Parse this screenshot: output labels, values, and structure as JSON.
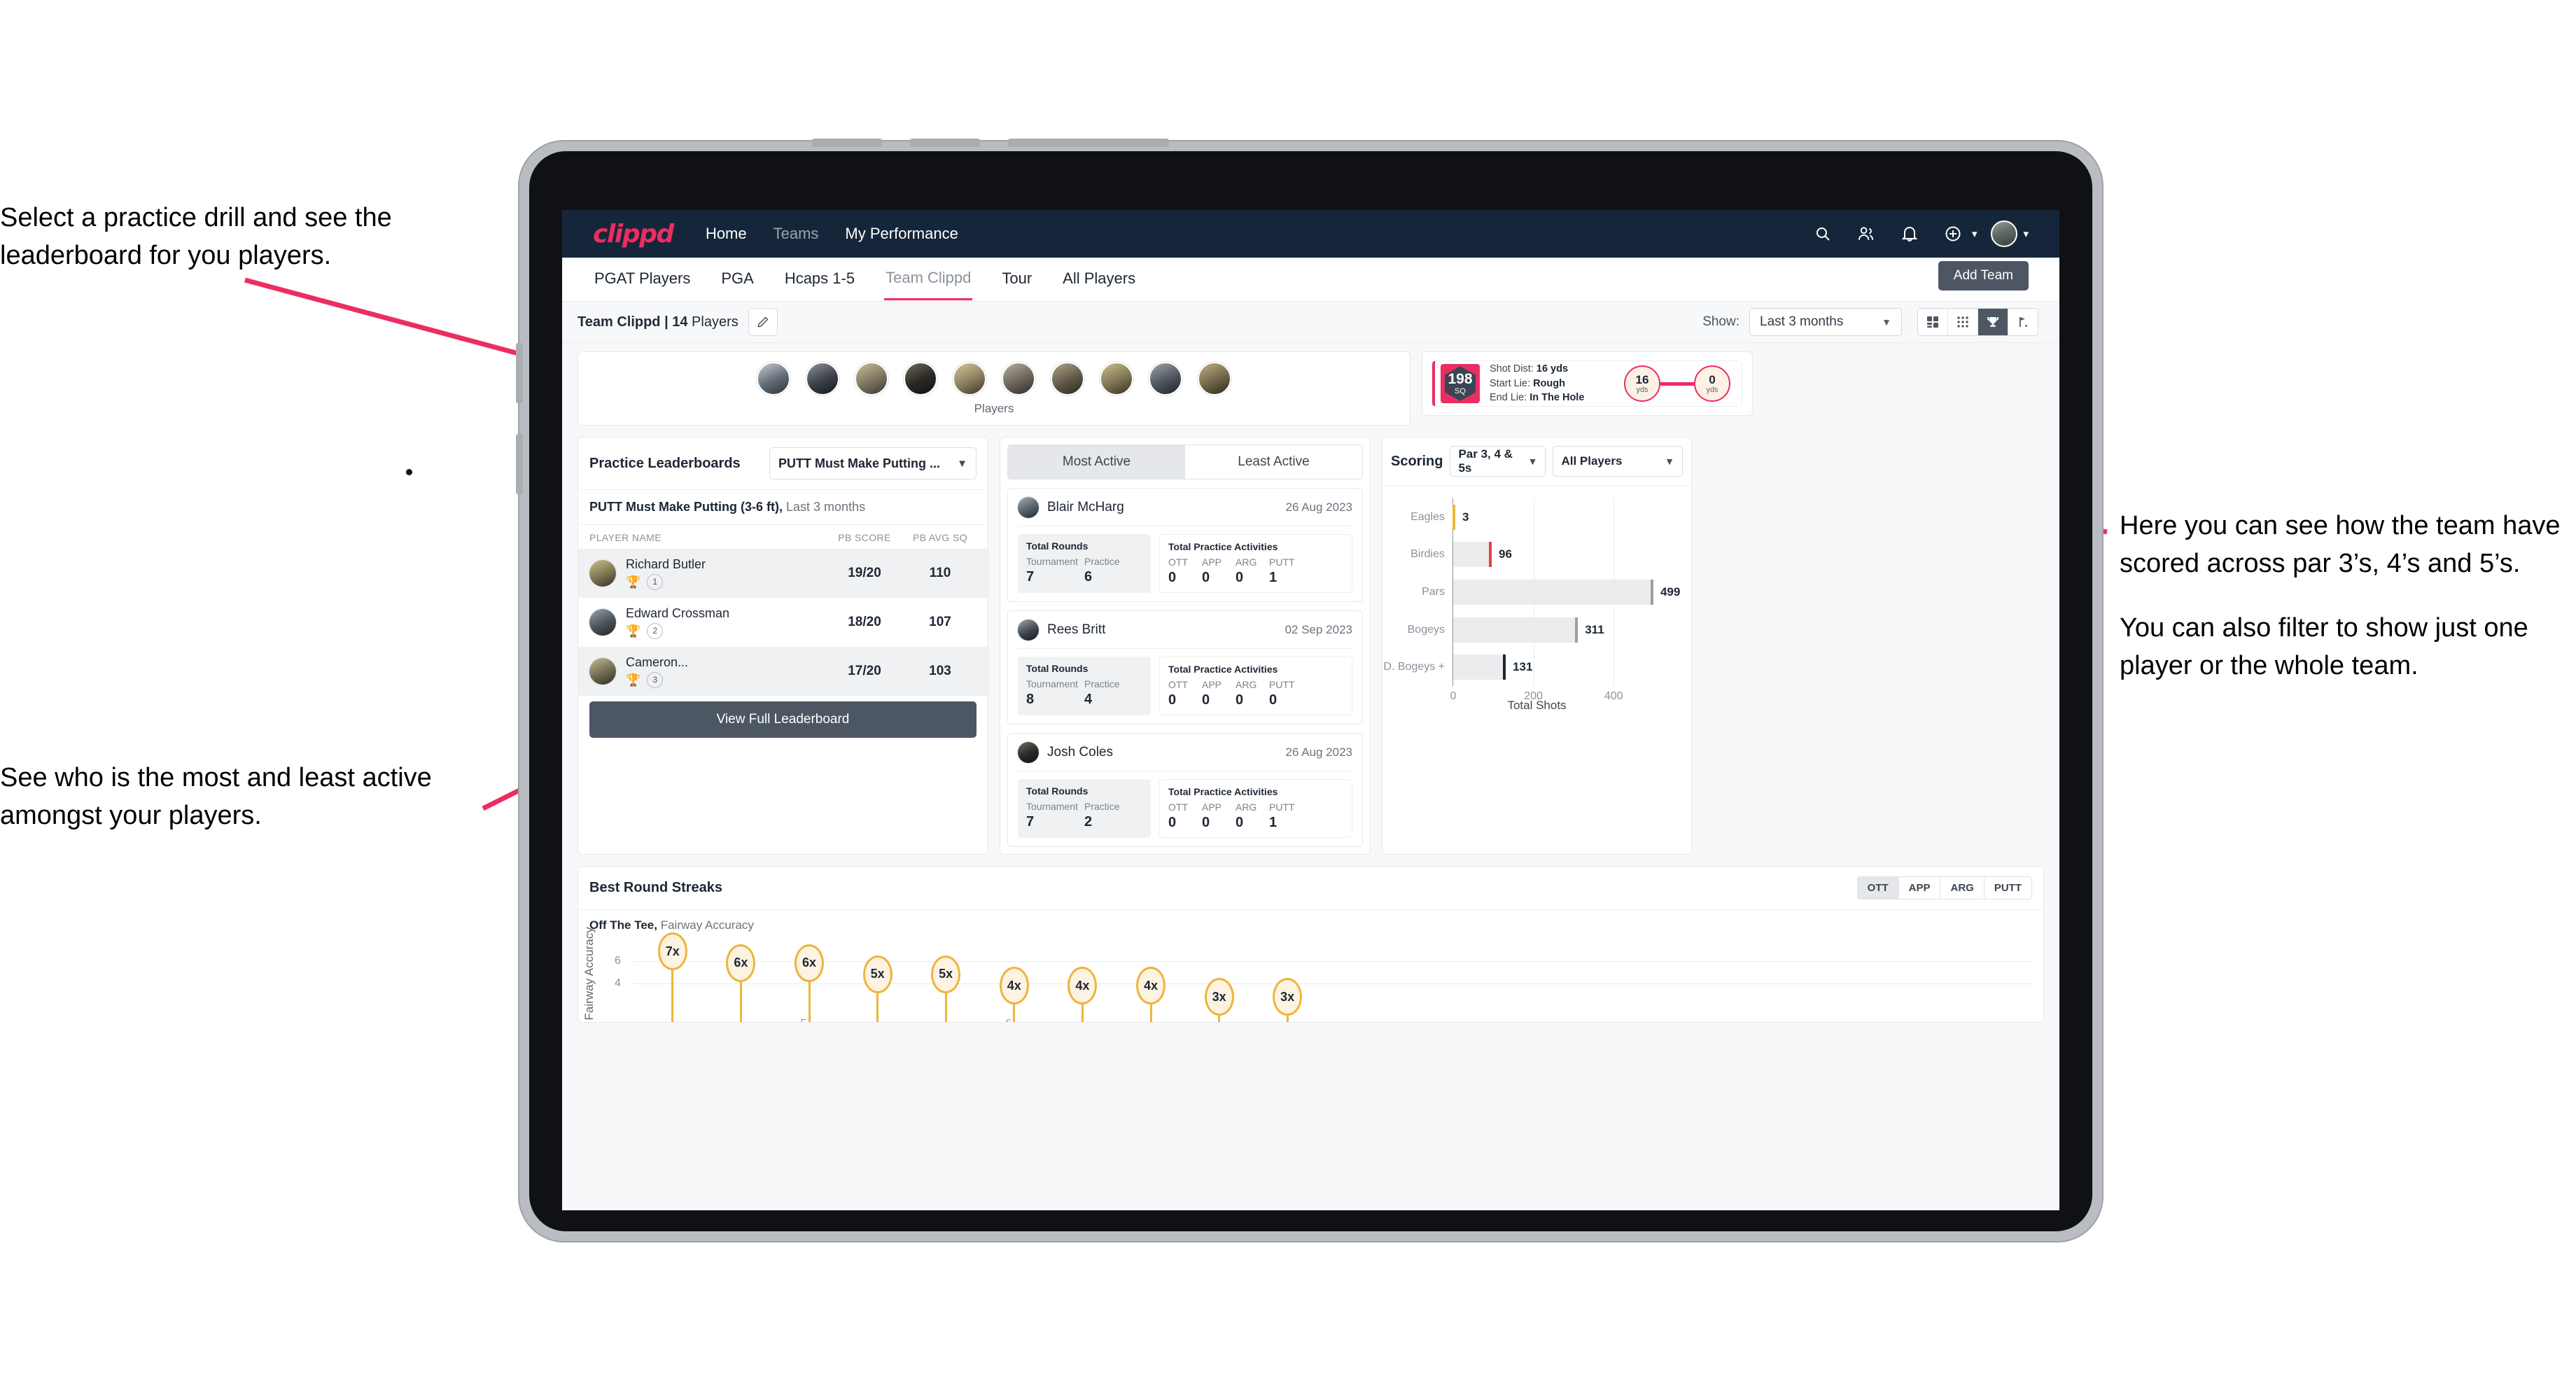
{
  "annotations": {
    "left_top": "Select a practice drill and see the leaderboard for you players.",
    "left_bottom": "See who is the most and least active amongst your players.",
    "right_1": "Here you can see how the team have scored across par 3’s, 4’s and 5’s.",
    "right_2": "You can also filter to show just one player or the whole team."
  },
  "appbar": {
    "logo": "clippd",
    "nav": [
      {
        "label": "Home",
        "active": true
      },
      {
        "label": "Teams",
        "active": false
      },
      {
        "label": "My Performance",
        "active": true
      }
    ],
    "icons": [
      "search-icon",
      "people-icon",
      "bell-icon",
      "plus-circle-icon",
      "avatar"
    ]
  },
  "tabs": {
    "items": [
      "PGAT Players",
      "PGA",
      "Hcaps 1-5",
      "Team Clippd",
      "Tour",
      "All Players"
    ],
    "active": "Team Clippd",
    "add_team_label": "Add Team"
  },
  "subbar": {
    "team_label_bold": "Team Clippd | 14",
    "team_label_rest": "Players",
    "edit_icon": "pencil-icon",
    "show_label": "Show:",
    "range_value": "Last 3 months",
    "view_modes": [
      {
        "name": "dashboard-view",
        "active": false
      },
      {
        "name": "grid-view",
        "active": false
      },
      {
        "name": "trophy-view",
        "active": true
      },
      {
        "name": "course-view",
        "active": false
      }
    ]
  },
  "players_strip": {
    "caption": "Players",
    "avatar_count": 10
  },
  "shot_detail": {
    "badge_value": "198",
    "badge_unit": "SQ",
    "lines": [
      {
        "label": "Shot Dist:",
        "value": "16 yds"
      },
      {
        "label": "Start Lie:",
        "value": "Rough"
      },
      {
        "label": "End Lie:",
        "value": "In The Hole"
      }
    ],
    "start_circle": {
      "value": "16",
      "unit": "yds"
    },
    "end_circle": {
      "value": "0",
      "unit": "yds"
    }
  },
  "leaderboard": {
    "title": "Practice Leaderboards",
    "drill_selected": "PUTT Must Make Putting ...",
    "subtitle_bold": "PUTT Must Make Putting (3-6 ft),",
    "subtitle_rest": "Last 3 months",
    "columns": [
      "PLAYER NAME",
      "PB SCORE",
      "PB AVG SQ"
    ],
    "rows": [
      {
        "name": "Richard Butler",
        "rank": "1",
        "trophy": "gold",
        "score": "19/20",
        "sq": "110"
      },
      {
        "name": "Edward Crossman",
        "rank": "2",
        "trophy": "silver",
        "score": "18/20",
        "sq": "107"
      },
      {
        "name": "Cameron...",
        "rank": "3",
        "trophy": "bronze",
        "score": "17/20",
        "sq": "103"
      }
    ],
    "button_label": "View Full Leaderboard"
  },
  "activity": {
    "tabs": [
      {
        "label": "Most Active",
        "active": true
      },
      {
        "label": "Least Active",
        "active": false
      }
    ],
    "rounds_title": "Total Rounds",
    "rounds_keys": [
      "Tournament",
      "Practice"
    ],
    "practice_title": "Total Practice Activities",
    "practice_keys": [
      "OTT",
      "APP",
      "ARG",
      "PUTT"
    ],
    "cards": [
      {
        "name": "Blair McHarg",
        "date": "26 Aug 2023",
        "tournament": "7",
        "practice": "6",
        "ott": "0",
        "app": "0",
        "arg": "0",
        "putt": "1"
      },
      {
        "name": "Rees Britt",
        "date": "02 Sep 2023",
        "tournament": "8",
        "practice": "4",
        "ott": "0",
        "app": "0",
        "arg": "0",
        "putt": "0"
      },
      {
        "name": "Josh Coles",
        "date": "26 Aug 2023",
        "tournament": "7",
        "practice": "2",
        "ott": "0",
        "app": "0",
        "arg": "0",
        "putt": "1"
      }
    ]
  },
  "scoring": {
    "title": "Scoring",
    "par_filter": "Par 3, 4 & 5s",
    "player_filter": "All Players",
    "chart_data": {
      "type": "bar",
      "orientation": "horizontal",
      "title": "Scoring",
      "categories": [
        "Eagles",
        "Birdies",
        "Pars",
        "Bogeys",
        "D. Bogeys +"
      ],
      "values": [
        3,
        96,
        499,
        311,
        131
      ],
      "cap_colors": [
        "#eeb43c",
        "#e8413f",
        "#9aa0a6",
        "#9aa0a6",
        "#1d2733"
      ],
      "xlabel": "Total Shots",
      "ylabel": "",
      "xlim": [
        0,
        520
      ],
      "xticks": [
        0,
        200,
        400
      ],
      "grid": true,
      "legend": "none"
    }
  },
  "streaks": {
    "title": "Best Round Streaks",
    "pills": [
      {
        "label": "OTT",
        "active": true
      },
      {
        "label": "APP",
        "active": false
      },
      {
        "label": "ARG",
        "active": false
      },
      {
        "label": "PUTT",
        "active": false
      }
    ],
    "subtitle_bold": "Off The Tee,",
    "subtitle_rest": "Fairway Accuracy",
    "chart_data": {
      "type": "bar",
      "variant": "lollipop",
      "title": "Off The Tee, Fairway Accuracy",
      "ylabel": "reak, Fairway Accuracy",
      "xlabel": "",
      "categories": [
        "",
        "",
        "E",
        "",
        "",
        "S",
        "",
        "",
        "",
        ""
      ],
      "values": [
        7,
        6,
        6,
        5,
        5,
        4,
        4,
        4,
        3,
        3
      ],
      "labels": [
        "7x",
        "6x",
        "6x",
        "5x",
        "5x",
        "4x",
        "4x",
        "4x",
        "3x",
        "3x"
      ],
      "yticks": [
        4,
        6
      ],
      "ylim": [
        0,
        8
      ],
      "grid": true,
      "legend": "none"
    }
  }
}
